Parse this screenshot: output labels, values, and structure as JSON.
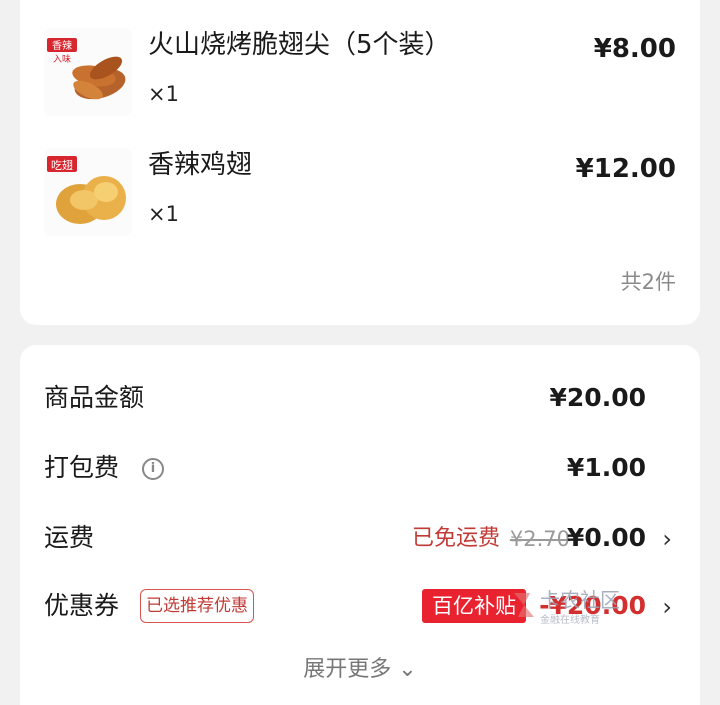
{
  "items": [
    {
      "name": "火山烧烤脆翅尖（5个装）",
      "qty": "×1",
      "price": "¥8.00",
      "thumb_badge_1": "香辣",
      "thumb_badge_2": "入味"
    },
    {
      "name": "香辣鸡翅",
      "qty": "×1",
      "price": "¥12.00",
      "thumb_badge": "吃翅"
    }
  ],
  "total_count": "共2件",
  "fees": {
    "subtotal": {
      "label": "商品金额",
      "value": "¥20.00"
    },
    "packing": {
      "label": "打包费",
      "value": "¥1.00",
      "icon": "info-icon"
    },
    "shipping": {
      "label": "运费",
      "free_text": "已免运费",
      "original": "¥2.70",
      "value": "¥0.00"
    },
    "coupon": {
      "label": "优惠券",
      "tag": "已选推荐优惠",
      "badge": "百亿补贴",
      "value": "-¥20.00"
    }
  },
  "expand_more": "展开更多 ⌄",
  "watermark": {
    "line1": "卡农社区",
    "line2": "金融在线教育"
  },
  "colors": {
    "accent_red": "#e8232f",
    "text_red": "#c23a35",
    "muted": "#8a8a8a"
  }
}
